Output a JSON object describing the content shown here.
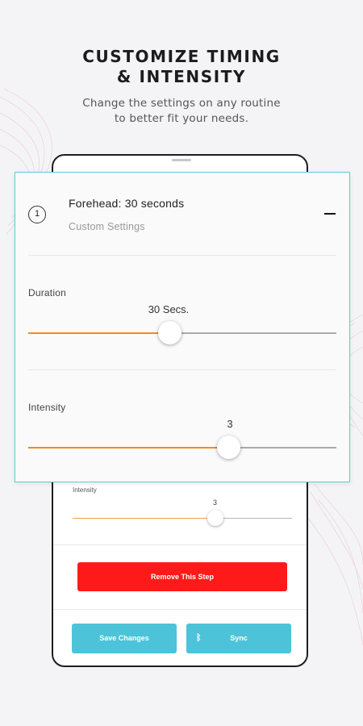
{
  "header": {
    "title_line1": "CUSTOMIZE TIMING",
    "title_line2": "& INTENSITY",
    "subtitle_line1": "Change the settings on any routine",
    "subtitle_line2": "to better fit your needs."
  },
  "step": {
    "number": "1",
    "title": "Forehead: 30 seconds",
    "subtitle": "Custom Settings",
    "collapse_icon": "minus-icon"
  },
  "duration": {
    "label": "Duration",
    "value_text": "30 Secs.",
    "level": 0.46
  },
  "intensity": {
    "label": "Intensity",
    "value_text": "3",
    "level": 0.65
  },
  "phone": {
    "intensity_label": "Intensity",
    "intensity_value": "3",
    "intensity_level": 0.65,
    "remove_label": "Remove This Step",
    "save_label": "Save Changes",
    "sync_label": "Sync",
    "sync_icon": "bluetooth-icon"
  },
  "colors": {
    "accent_teal": "#4cc3d9",
    "slider_orange": "#f08a24",
    "remove_red": "#ff1a1a",
    "card_border": "#5ccbdb"
  }
}
